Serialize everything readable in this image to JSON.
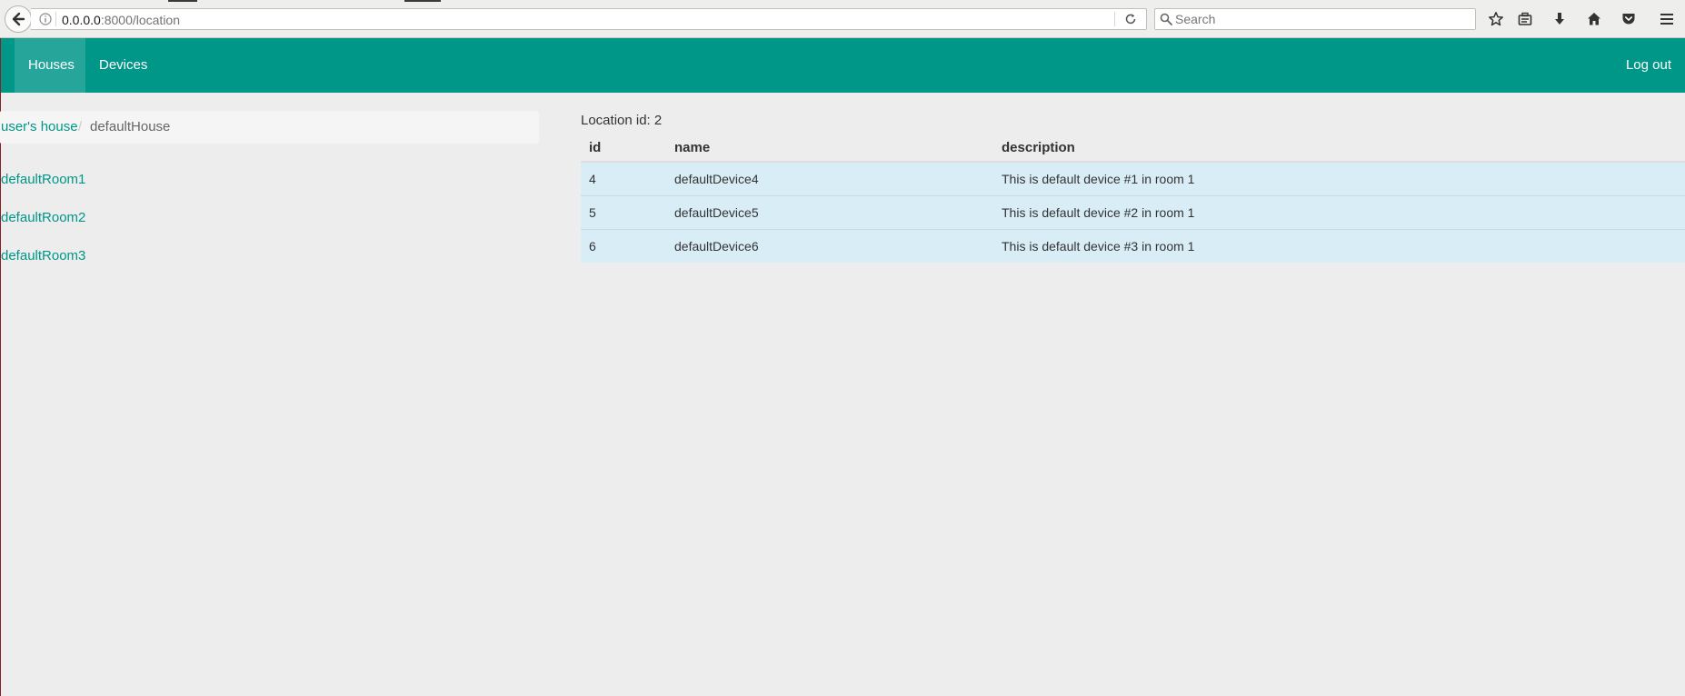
{
  "browser": {
    "url_host": "0.0.0.0",
    "url_path": ":8000/location",
    "search_placeholder": "Search",
    "icons": [
      "back-arrow-icon",
      "info-icon",
      "reload-icon",
      "search-icon",
      "star-icon",
      "clipboard-icon",
      "download-icon",
      "home-icon",
      "pocket-icon",
      "menu-icon"
    ]
  },
  "navbar": {
    "items": [
      {
        "label": "Houses",
        "active": true
      },
      {
        "label": "Devices",
        "active": false
      }
    ],
    "logout_label": "Log out",
    "color": "#009688",
    "active_color": "#26a69a"
  },
  "breadcrumb": {
    "parent": "user's house",
    "divider": "/",
    "current": "defaultHouse"
  },
  "rooms": [
    "defaultRoom1",
    "defaultRoom2",
    "defaultRoom3"
  ],
  "location": {
    "label": "Location id: 2"
  },
  "table": {
    "headers": [
      "id",
      "name",
      "description"
    ],
    "rows": [
      [
        "4",
        "defaultDevice4",
        "This is default device #1 in room 1"
      ],
      [
        "5",
        "defaultDevice5",
        "This is default device #2 in room 1"
      ],
      [
        "6",
        "defaultDevice6",
        "This is default device #3 in room 1"
      ]
    ],
    "row_color": "#d9edf7"
  }
}
